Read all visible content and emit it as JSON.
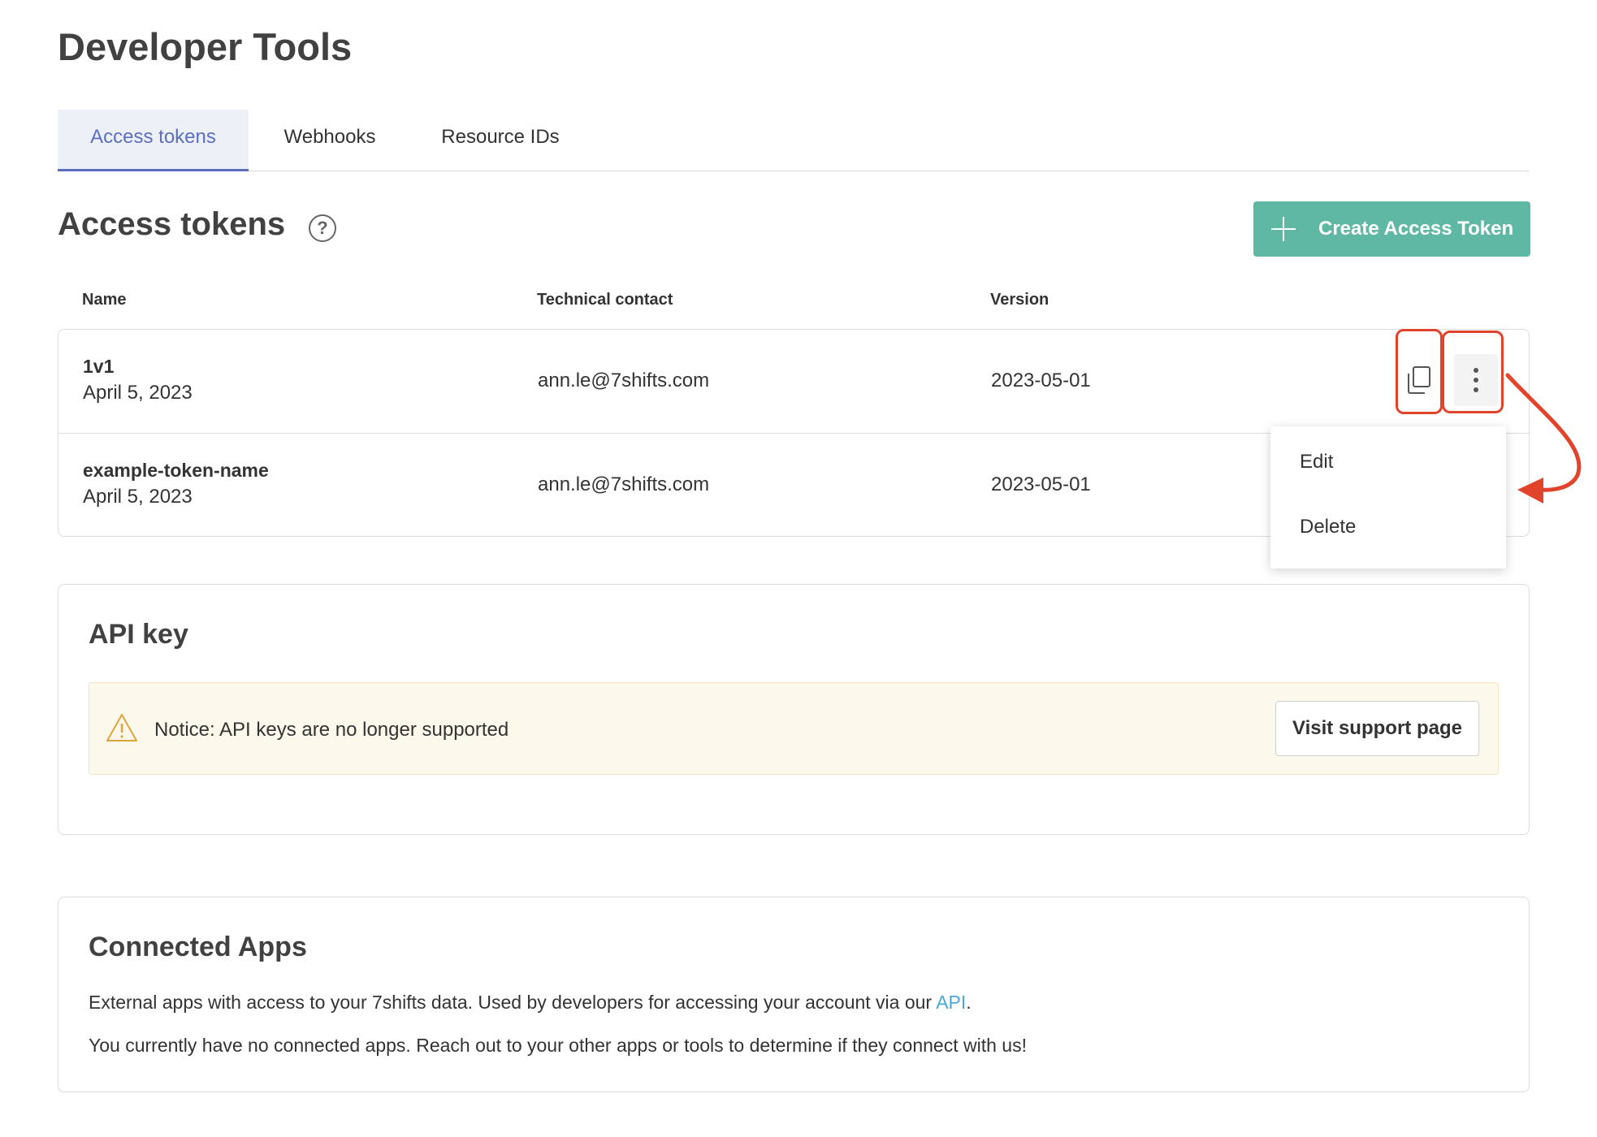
{
  "page": {
    "title": "Developer Tools"
  },
  "tabs": [
    {
      "label": "Access tokens",
      "active": true
    },
    {
      "label": "Webhooks",
      "active": false
    },
    {
      "label": "Resource IDs",
      "active": false
    }
  ],
  "access_tokens": {
    "title": "Access tokens",
    "help_icon": "question-circle-icon",
    "create_button": "Create Access Token",
    "columns": [
      "Name",
      "Technical contact",
      "Version"
    ],
    "rows": [
      {
        "name": "1v1",
        "date": "April 5, 2023",
        "contact": "ann.le@7shifts.com",
        "version": "2023-05-01"
      },
      {
        "name": "example-token-name",
        "date": "April 5, 2023",
        "contact": "ann.le@7shifts.com",
        "version": "2023-05-01"
      }
    ],
    "row_actions": {
      "copy_icon": "copy-icon",
      "more_icon": "kebab-vertical-icon"
    },
    "menu": {
      "edit": "Edit",
      "delete": "Delete"
    }
  },
  "api_key": {
    "title": "API key",
    "notice": "Notice: API keys are no longer supported",
    "support_button": "Visit support page",
    "warning_icon": "warning-triangle-icon"
  },
  "connected_apps": {
    "title": "Connected Apps",
    "description_prefix": "External apps with access to your 7shifts data. Used by developers for accessing your account via our ",
    "description_link": "API",
    "description_suffix": ".",
    "empty_text": "You currently have no connected apps. Reach out to your other apps or tools to determine if they connect with us!"
  },
  "colors": {
    "accent": "#5a6fc0",
    "primary_button": "#5fb8a4",
    "highlight": "#e2432b",
    "link": "#4aa8d8",
    "notice_bg": "#fdf8ec"
  }
}
